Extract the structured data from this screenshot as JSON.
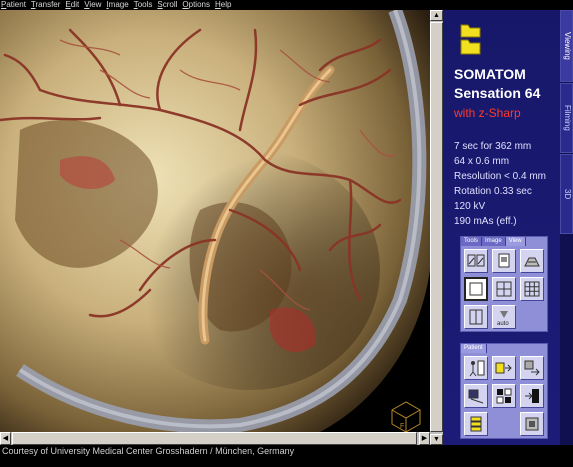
{
  "menu": [
    "Patient",
    "Transfer",
    "Edit",
    "View",
    "Image",
    "Tools",
    "Scroll",
    "Options",
    "Help"
  ],
  "panel": {
    "brand_line1": "SOMATOM",
    "brand_line2": "Sensation 64",
    "brand_line3": "with z-Sharp",
    "specs": [
      "7 sec for 362 mm",
      "64 x 0.6 mm",
      "Resolution < 0.4 mm",
      "Rotation 0.33 sec",
      "120 kV",
      "190 mAs (eff.)"
    ],
    "side_tabs": [
      "Viewing",
      "Filming",
      "3D"
    ],
    "tool_tabs": [
      "Tools",
      "Image",
      "View"
    ],
    "patient_tab": "Patient",
    "auto_label": "auto"
  },
  "footer": "Courtesy of University Medical Center Grosshadern / München, Germany",
  "colors": {
    "panel_bg": "#1a1a70",
    "brand_red": "#ff3a2a",
    "toolbox": "#8f8fd8"
  }
}
